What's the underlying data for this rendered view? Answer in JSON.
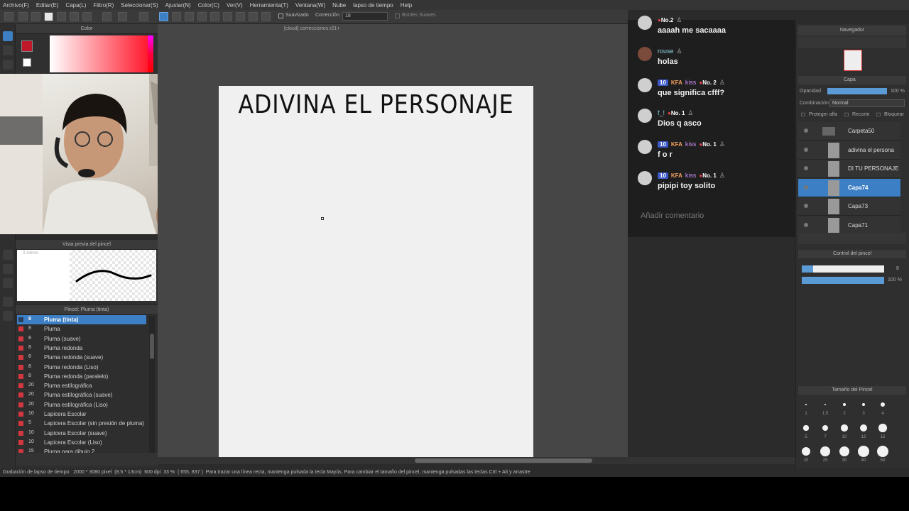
{
  "menu": [
    "Archivo(F)",
    "Editar(E)",
    "Capa(L)",
    "Filtro(R)",
    "Seleccionar(S)",
    "Ajustar(N)",
    "Color(C)",
    "Ver(V)",
    "Herramienta(T)",
    "Ventana(W)",
    "Nube",
    "lapso de tiempo",
    "Help"
  ],
  "toolbar": {
    "suavizado": "Suavizado",
    "correccion_label": "Corrección",
    "correccion_value": "18",
    "bordes": "Bordes Suaves"
  },
  "panels": {
    "color_title": "Color",
    "brush_preview_title": "Vista previa del pincel",
    "brush_preview_size": "0.34mm",
    "brush_list_title": "Pincel: Pluma (tinta)",
    "navigator_title": "Navegador",
    "layer_title": "Capa",
    "brush_control_title": "Control del pincel",
    "brush_size_title": "Tamaño del Pincel"
  },
  "colors": {
    "main": "#c0182a",
    "sub": "#ffffff",
    "accent": "#3d7fc4"
  },
  "brushes": [
    {
      "size": "8",
      "name": "Pluma (tinta)",
      "selected": true
    },
    {
      "size": "8",
      "name": "Pluma"
    },
    {
      "size": "8",
      "name": "Pluma (suave)"
    },
    {
      "size": "8",
      "name": "Pluma redonda"
    },
    {
      "size": "8",
      "name": "Pluma redonda (suave)"
    },
    {
      "size": "8",
      "name": "Pluma redonda (Liso)"
    },
    {
      "size": "8",
      "name": "Pluma redonda (paralelo)"
    },
    {
      "size": "20",
      "name": "Pluma estilográfica"
    },
    {
      "size": "20",
      "name": "Pluma estilográfica (suave)"
    },
    {
      "size": "20",
      "name": "Pluma estilográfica (Liso)"
    },
    {
      "size": "10",
      "name": "Lapicera Escolar"
    },
    {
      "size": "5",
      "name": "Lapicera Escolar (sin presión de pluma)"
    },
    {
      "size": "10",
      "name": "Lapicera Escolar (suave)"
    },
    {
      "size": "10",
      "name": "Lapicera Escolar (Liso)"
    },
    {
      "size": "15",
      "name": "Pluma para dibujo 2"
    }
  ],
  "document": {
    "tab": "[cloud] correcciones.r21+",
    "page_title": "ADIVINA EL PERSONAJE"
  },
  "chat": {
    "messages": [
      {
        "user": "",
        "text": "aaaah me sacaaaa",
        "partial": true,
        "no": "No.2"
      },
      {
        "user": "rouse",
        "text": "holas",
        "level": "",
        "fan": "",
        "no": ""
      },
      {
        "user": "kiss",
        "text": "que significa cfff?",
        "level": "10",
        "fan": "KFA",
        "no": "No. 2"
      },
      {
        "user": "f_!",
        "text": "Dios q asco",
        "level": "",
        "fan": "",
        "no": "No. 1"
      },
      {
        "user": "kiss",
        "text": "f o r",
        "level": "10",
        "fan": "KFA",
        "no": "No. 1"
      },
      {
        "user": "kiss",
        "text": "pipipi toy solito",
        "level": "10",
        "fan": "KFA",
        "no": "No. 1"
      }
    ],
    "input_placeholder": "Añadir comentario"
  },
  "layers": {
    "opacity_label": "Opacidad",
    "opacity_value": "100 %",
    "blend_label": "Combinación",
    "blend_value": "Normal",
    "protect": "Proteger alfa",
    "clip": "Recorte",
    "lock": "Bloquear",
    "items": [
      {
        "name": "Carpeta50",
        "type": "folder"
      },
      {
        "name": "adivina el persona",
        "type": "text"
      },
      {
        "name": "DI TU PERSONAJE",
        "type": "text"
      },
      {
        "name": "Capa74",
        "type": "raster",
        "selected": true
      },
      {
        "name": "Capa73",
        "type": "raster"
      },
      {
        "name": "Capa71",
        "type": "raster"
      }
    ]
  },
  "brush_control": {
    "size_value": "8",
    "opacity_value": "100 %"
  },
  "brush_sizes": [
    "1",
    "1.5",
    "2",
    "3",
    "4",
    "5",
    "7",
    "10",
    "12",
    "15",
    "20",
    "25",
    "30",
    "40",
    "50"
  ],
  "status": {
    "left": "Grabación de lapso de tiempo",
    "size": "2000 * 3080 pixel",
    "cm": "(8.5 * 13cm)",
    "dpi": "600 dpi",
    "zoom": "33 %",
    "coords": "( 655, 837 )",
    "hint": "Para trazar una línea recta, mantenga pulsada la tecla Mayús. Para cambiar el tamaño del pincel, mantenga pulsadas las teclas Ctrl + Alt y arrastre"
  }
}
